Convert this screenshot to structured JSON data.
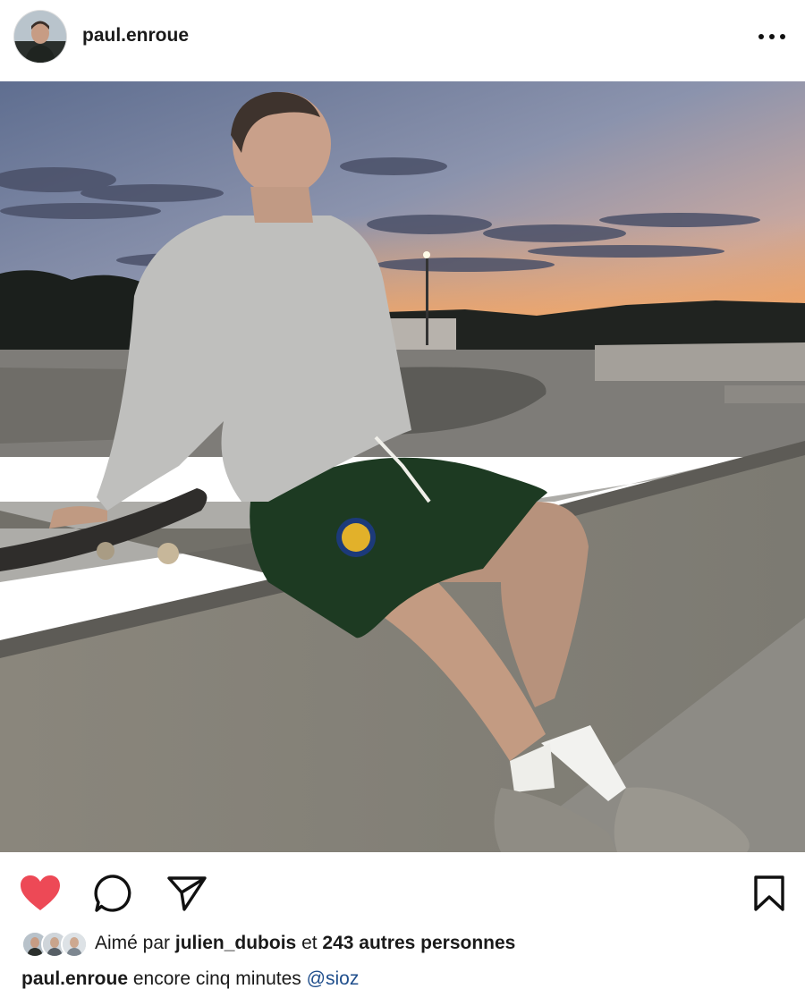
{
  "post": {
    "username": "paul.enroue",
    "more_menu_icon": "more-dots-icon",
    "photo": {
      "description_icon": "post-photo"
    },
    "actions": {
      "like_icon": "heart-icon",
      "liked": true,
      "like_color": "#ed4956",
      "comment_icon": "comment-icon",
      "share_icon": "send-icon",
      "save_icon": "bookmark-icon"
    },
    "likes": {
      "prefix": "Aimé par",
      "liked_by_user": "julien_dubois",
      "connector": "et",
      "others": "243 autres personnes",
      "avatar_count": 3
    },
    "caption": {
      "username": "paul.enroue",
      "text": "encore cinq minutes",
      "mention": "@sioz"
    }
  }
}
